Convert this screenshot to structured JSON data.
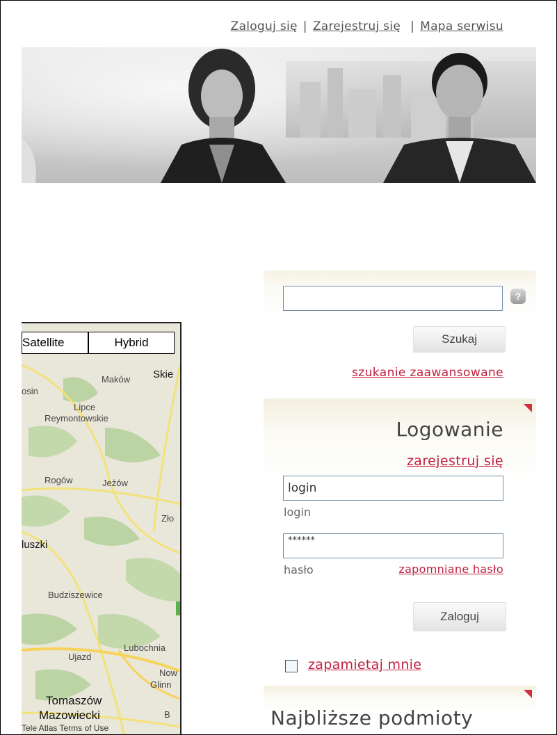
{
  "header": {
    "links": [
      {
        "label": "Zaloguj się"
      },
      {
        "label": "Zarejestruj się"
      },
      {
        "label": "Mapa serwisu"
      }
    ],
    "separator": "|"
  },
  "map": {
    "tabs": [
      {
        "label": "Satellite"
      },
      {
        "label": "Hybrid"
      }
    ],
    "places": [
      "Maków",
      "Skie",
      "Lipce",
      "Reymontowskie",
      "osin",
      "Rogów",
      "Jeżów",
      "Zło",
      "luszki",
      "Budziszewice",
      "Lubochnia",
      "Ujazd",
      "Now",
      "Glinn",
      "Tomaszów",
      "Mazowiecki",
      "B"
    ],
    "footer": "Tele Atlas  Terms of Use"
  },
  "search": {
    "button": "Szukaj",
    "help_symbol": "?",
    "advanced_link": "szukanie zaawansowane"
  },
  "login": {
    "title": "Logowanie",
    "register_link": "zarejestruj się",
    "login_value": "login",
    "login_caption": "login",
    "password_value": "******",
    "password_caption": "hasło",
    "forgot_link": "zapomniane hasło",
    "button": "Zaloguj",
    "remember_label": "zapamietaj mnie"
  },
  "nearest": {
    "title": "Najbliższe podmioty"
  },
  "colors": {
    "link_red": "#c0203e",
    "input_border": "#6e8fa8",
    "panel_tint": "#f4f0e0"
  }
}
